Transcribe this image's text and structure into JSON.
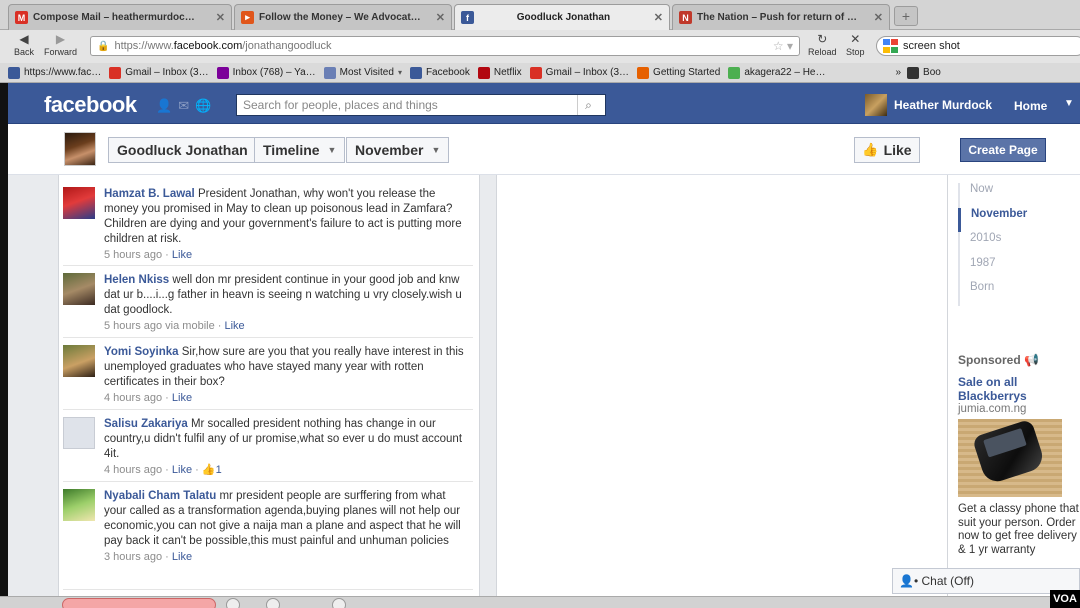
{
  "tabs": [
    {
      "label": "Compose Mail – heathermurdoc…",
      "icon": "gmail-icon",
      "color": "#d93025",
      "active": false
    },
    {
      "label": "Follow the Money – We Advocat…",
      "icon": "site-icon",
      "color": "#e0561b",
      "active": false
    },
    {
      "label": "Goodluck Jonathan",
      "icon": "facebook-icon",
      "color": "#3b5998",
      "active": true
    },
    {
      "label": "The Nation – Push for return of …",
      "icon": "news-icon",
      "color": "#c0392b",
      "active": false
    }
  ],
  "nav": {
    "back": "Back",
    "forward": "Forward",
    "reload": "Reload",
    "stop": "Stop",
    "url_prefix": "https://www.",
    "url_host": "facebook.com",
    "url_path": "/jonathangoodluck",
    "search_value": "screen shot"
  },
  "bookmarks": [
    {
      "label": "https://www.fac…",
      "color": "#3b5998"
    },
    {
      "label": "Gmail – Inbox (3…",
      "color": "#d93025"
    },
    {
      "label": "Inbox (768) – Ya…",
      "color": "#7b0099"
    },
    {
      "label": "Most Visited",
      "color": "#6a7fb5",
      "dropdown": true
    },
    {
      "label": "Facebook",
      "color": "#3b5998"
    },
    {
      "label": "Netflix",
      "color": "#b20710"
    },
    {
      "label": "Gmail – Inbox (3…",
      "color": "#d93025"
    },
    {
      "label": "Getting Started",
      "color": "#e66000"
    },
    {
      "label": "akagera22 – He…",
      "color": "#4caf50"
    }
  ],
  "bookmarks_more": "Boo",
  "fb": {
    "logo": "facebook",
    "search_placeholder": "Search for people, places and things",
    "user_name": "Heather Murdock",
    "home": "Home",
    "page_name": "Goodluck Jonathan",
    "timeline": "Timeline",
    "month": "November",
    "like": "Like",
    "create_page": "Create Page"
  },
  "comments": [
    {
      "name": "Hamzat B. Lawal",
      "text": "President Jonathan, why won't you release the money you promised in May to clean up poisonous lead in Zamfara? Children are dying and your government's failure to act is putting more children at risk.",
      "time": "5 hours ago",
      "via": "",
      "like": "Like",
      "likes": ""
    },
    {
      "name": "Helen Nkiss",
      "text": "well don mr president continue in your good job and knw dat ur b....i...g father in heavn is seeing n watching u vry closely.wish u dat goodlock.",
      "time": "5 hours ago",
      "via": "via mobile",
      "like": "Like",
      "likes": ""
    },
    {
      "name": "Yomi Soyinka",
      "text": "Sir,how sure are you that you really have interest in this unemployed graduates who have stayed many year with rotten certificates in their box?",
      "time": "4 hours ago",
      "via": "",
      "like": "Like",
      "likes": ""
    },
    {
      "name": "Salisu Zakariya",
      "text": "Mr socalled president nothing has change in our country,u didn't fulfil any of ur promise,what so ever u do must account 4it.",
      "time": "4 hours ago",
      "via": "",
      "like": "Like",
      "likes": "1"
    },
    {
      "name": "Nyabali Cham Talatu",
      "text": "mr president people are surffering from what your called as a transformation agenda,buying planes will not help our economic,you can not give a naija man a plane and aspect that he will pay back it can't be possible,this must painful and unhuman policies",
      "time": "3 hours ago",
      "via": "",
      "like": "Like",
      "likes": ""
    }
  ],
  "scrubber": [
    "Now",
    "November",
    "2010s",
    "1987",
    "Born"
  ],
  "ad": {
    "sponsored": "Sponsored",
    "title": "Sale on all Blackberrys",
    "domain": "jumia.com.ng",
    "text": "Get a classy phone that suit your person. Order now to get free delivery & 1 yr warranty"
  },
  "chat": "Chat (Off)",
  "watermark": "VOA"
}
